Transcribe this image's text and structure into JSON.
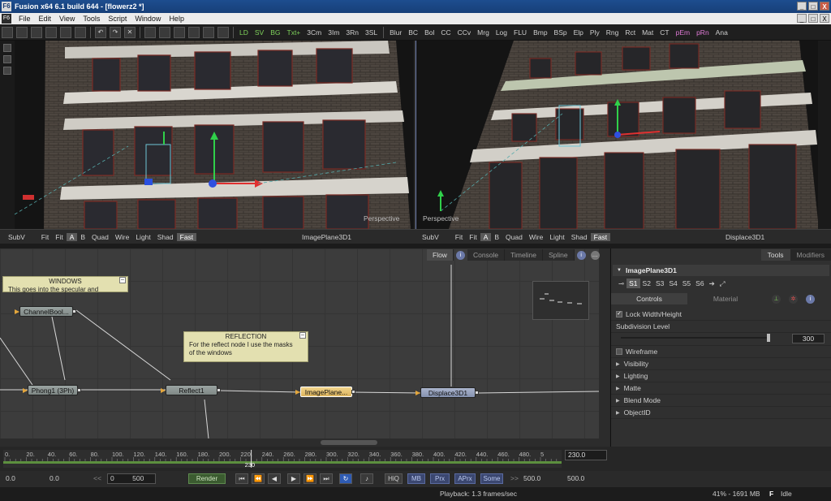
{
  "window": {
    "title": "Fusion x64 6.1 build 644 - [flowerz2 *]",
    "app_icon": "F6",
    "minimize": "_",
    "maximize": "□",
    "close": "X"
  },
  "menu": {
    "items": [
      "File",
      "Edit",
      "View",
      "Tools",
      "Script",
      "Window",
      "Help"
    ]
  },
  "toolbar": {
    "tools_a": [
      "LD",
      "SV",
      "BG",
      "Txt+",
      "3Cm",
      "3Im",
      "3Rn",
      "3SL"
    ],
    "tools_b": [
      "Blur",
      "BC",
      "Bol",
      "CC",
      "CCv",
      "Mrg",
      "Log",
      "FLU",
      "Bmp",
      "BSp",
      "Elp",
      "Ply",
      "Rng",
      "Rct",
      "Mat",
      "CT",
      "pEm",
      "pRn",
      "Ana"
    ]
  },
  "viewport_left": {
    "label": "Perspective",
    "bar": {
      "subv": "SubV",
      "fit1": "Fit",
      "fit2": "Fit",
      "a": "A",
      "b": "B",
      "quad": "Quad",
      "wire": "Wire",
      "light": "Light",
      "shad": "Shad",
      "fast": "Fast",
      "name": "ImagePlane3D1"
    }
  },
  "viewport_right": {
    "label": "Perspective",
    "bar": {
      "subv": "SubV",
      "fit1": "Fit",
      "fit2": "Fit",
      "a": "A",
      "b": "B",
      "quad": "Quad",
      "wire": "Wire",
      "light": "Light",
      "shad": "Shad",
      "fast": "Fast",
      "name": "Displace3D1"
    }
  },
  "flow": {
    "tabs": [
      "Flow",
      "Console",
      "Timeline",
      "Spline"
    ],
    "notes": [
      {
        "title": "WINDOWS",
        "body": "This goes into the specular and"
      },
      {
        "title": "REFLECTION",
        "body_lines": [
          "For the reflect node I use the masks",
          "of the windows"
        ]
      }
    ],
    "nodes": [
      "ChannelBool...",
      "Phong1 (3Ph)",
      "Reflect1",
      "ImagePlane...",
      "Displace3D1"
    ]
  },
  "panel": {
    "tabs": [
      "Tools",
      "Modifiers"
    ],
    "tool_name": "ImagePlane3D1",
    "scene_buttons": [
      "S1",
      "S2",
      "S3",
      "S4",
      "S5",
      "S6"
    ],
    "subtabs": [
      "Controls",
      "Material"
    ],
    "lock": "Lock Width/Height",
    "subdivision_label": "Subdivision Level",
    "subdivision_value": "300",
    "subdivision_fraction": 0.97,
    "wireframe": "Wireframe",
    "sections": [
      "Visibility",
      "Lighting",
      "Matte",
      "Blend Mode",
      "ObjectID"
    ]
  },
  "timeline": {
    "ticks": [
      "0.",
      "20.",
      "40.",
      "60.",
      "80.",
      "100.",
      "120.",
      "140.",
      "160.",
      "180.",
      "200.",
      "220.",
      "240.",
      "260.",
      "280.",
      "300.",
      "320.",
      "340.",
      "360.",
      "380.",
      "400.",
      "420.",
      "440.",
      "460.",
      "480.",
      "5"
    ],
    "current_marker": "230",
    "current_field": "230.0"
  },
  "transport": {
    "start": "0.0",
    "global_start": "0.0",
    "range_lo": "0",
    "range_hi": "500",
    "render": "Render",
    "hiq": "HiQ",
    "mb": "MB",
    "prx": "Prx",
    "aprx": "APrx",
    "some": "Some",
    "end": "500.0",
    "global_end": "500.0",
    "prev_glyph": "<<",
    "next_glyph": ">>"
  },
  "status": {
    "playback": "Playback: 1.3 frames/sec",
    "memory": "41% - 1691 MB",
    "state": "Idle",
    "fusion_logo": "F"
  },
  "colors": {
    "title_bg": "#1d4d8f",
    "node_yellow": "#f2d58c",
    "node_blue": "#aab4cc",
    "render_green": "#3b5b30"
  }
}
